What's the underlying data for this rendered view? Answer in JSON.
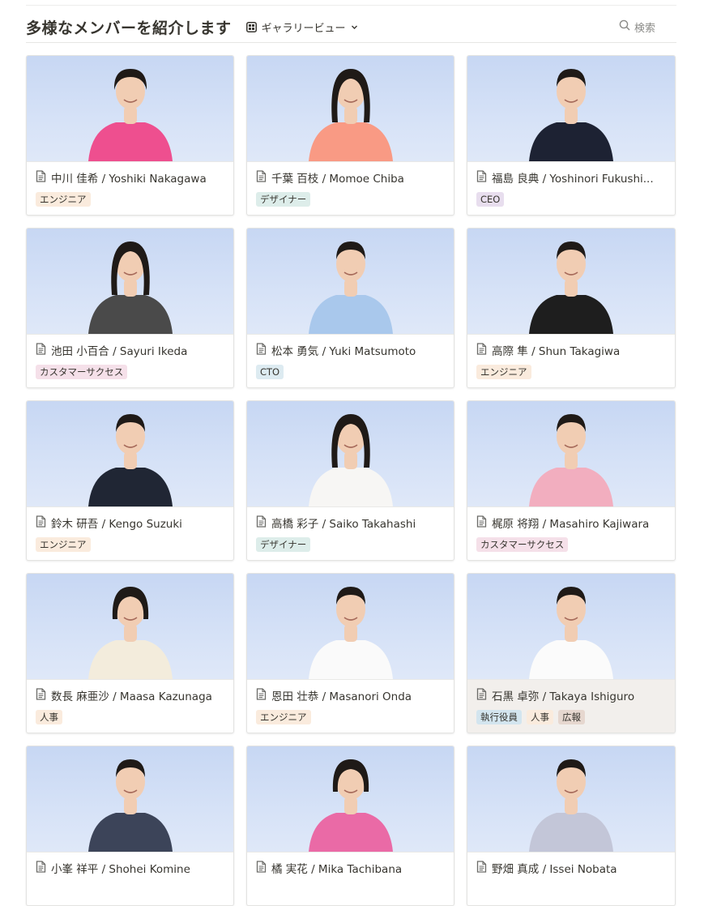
{
  "header": {
    "title": "多様なメンバーを紹介します",
    "view_label": "ギャラリービュー",
    "view_icon": "gallery-grid-icon",
    "chevron_icon": "chevron-down-icon",
    "search_label": "検索",
    "search_icon": "search-icon"
  },
  "tag_colors": {
    "エンジニア": "#faebdd",
    "デザイナー": "#ddedea",
    "CEO": "#e8deee",
    "カスタマーサクセス": "#f5e0e9",
    "CTO": "#ddebf1",
    "人事": "#faebdd",
    "執行役員": "#d3e5ef",
    "広報": "#e6d7cf"
  },
  "members": [
    {
      "name": "中川 佳希 / Yoshiki Nakagawa",
      "tags": [
        "エンジニア"
      ],
      "shirt": "#ee4f8f",
      "hair": "long-m"
    },
    {
      "name": "千葉 百枝 / Momoe Chiba",
      "tags": [
        "デザイナー"
      ],
      "shirt": "#f99a84",
      "hair": "long-f"
    },
    {
      "name": "福島 良典 / Yoshinori Fukushi...",
      "tags": [
        "CEO"
      ],
      "shirt": "#1d2233",
      "hair": "short"
    },
    {
      "name": "池田 小百合 / Sayuri Ikeda",
      "tags": [
        "カスタマーサクセス"
      ],
      "shirt": "#4a4a4a",
      "hair": "long-f"
    },
    {
      "name": "松本 勇気 / Yuki Matsumoto",
      "tags": [
        "CTO"
      ],
      "shirt": "#a9c8ec",
      "hair": "short"
    },
    {
      "name": "高際 隼 / Shun Takagiwa",
      "tags": [
        "エンジニア"
      ],
      "shirt": "#1e1e1e",
      "hair": "short"
    },
    {
      "name": "鈴木 研吾 / Kengo Suzuki",
      "tags": [
        "エンジニア"
      ],
      "shirt": "#202634",
      "hair": "short"
    },
    {
      "name": "高橋 彩子 / Saiko Takahashi",
      "tags": [
        "デザイナー"
      ],
      "shirt": "#f7f6f4",
      "hair": "long-f"
    },
    {
      "name": "梶原 将翔 / Masahiro Kajiwara",
      "tags": [
        "カスタマーサクセス"
      ],
      "shirt": "#f2aebf",
      "hair": "short"
    },
    {
      "name": "数長 麻亜沙 / Maasa Kazunaga",
      "tags": [
        "人事"
      ],
      "shirt": "#f3ecdc",
      "hair": "bob"
    },
    {
      "name": "恩田 壮恭 / Masanori Onda",
      "tags": [
        "エンジニア"
      ],
      "shirt": "#fafafa",
      "hair": "short"
    },
    {
      "name": "石黒 卓弥 / Takaya Ishiguro",
      "tags": [
        "執行役員",
        "人事",
        "広報"
      ],
      "shirt": "#fbfbfb",
      "hair": "short",
      "highlight": true
    },
    {
      "name": "小峯 祥平 / Shohei Komine",
      "tags": [],
      "shirt": "#3c4459",
      "hair": "short"
    },
    {
      "name": "橘 実花 / Mika Tachibana",
      "tags": [],
      "shirt": "#ea6aa6",
      "hair": "bob"
    },
    {
      "name": "野畑 真成 / Issei Nobata",
      "tags": [],
      "shirt": "#c3c6d8",
      "hair": "short"
    }
  ]
}
